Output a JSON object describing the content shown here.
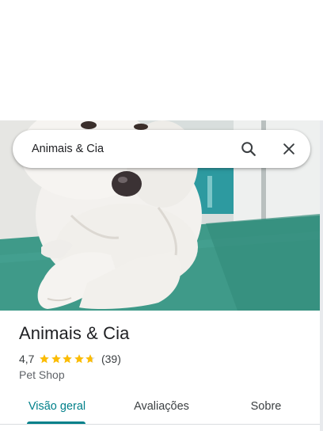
{
  "search": {
    "query": "Animais & Cia"
  },
  "place": {
    "name": "Animais & Cia",
    "rating": "4,7",
    "stars": 4.7,
    "review_count": "(39)",
    "category": "Pet Shop"
  },
  "tabs": [
    {
      "label": "Visão geral",
      "active": true
    },
    {
      "label": "Avaliações",
      "active": false
    },
    {
      "label": "Sobre",
      "active": false
    }
  ],
  "colors": {
    "accent": "#00808a",
    "star": "#fbbc04",
    "text": "#202124",
    "secondary": "#5f6368"
  },
  "icons": {
    "search": "search-icon",
    "close": "close-icon",
    "star": "star-icon"
  }
}
